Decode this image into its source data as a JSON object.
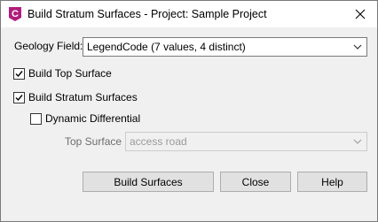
{
  "window": {
    "title": "Build Stratum Surfaces - Project: Sample Project",
    "app_icon_letter": "C"
  },
  "form": {
    "geology_field_label": "Geology Field:",
    "geology_field_value": "LegendCode (7 values, 4 distinct)",
    "build_top_surface_label": "Build Top Surface",
    "build_top_surface_checked": true,
    "build_stratum_surfaces_label": "Build Stratum Surfaces",
    "build_stratum_surfaces_checked": true,
    "dynamic_differential_label": "Dynamic Differential",
    "dynamic_differential_checked": false,
    "top_surface_label": "Top Surface",
    "top_surface_value": "access road",
    "top_surface_enabled": false
  },
  "buttons": {
    "build_label": "Build Surfaces",
    "close_label": "Close",
    "help_label": "Help"
  },
  "colors": {
    "app_icon_bg": "#b01c7c",
    "check_mark": "#000000"
  },
  "icons": [
    "app-icon",
    "close-icon",
    "chevron-down-icon",
    "check-icon"
  ]
}
